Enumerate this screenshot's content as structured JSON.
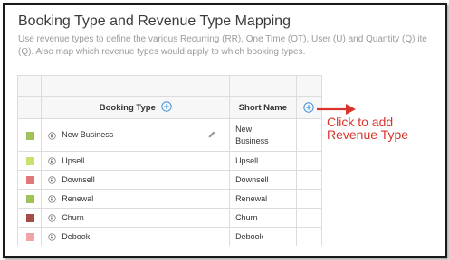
{
  "page": {
    "title": "Booking Type and Revenue Type Mapping",
    "description_line1": "Use revenue types to define the various Recurring (RR), One Time (OT), User (U) and Quantity (Q) ite",
    "description_line2": "(Q). Also map which revenue types would apply to which booking types."
  },
  "table": {
    "columns": {
      "booking_type": "Booking Type",
      "short_name": "Short Name"
    },
    "rows": [
      {
        "color": "#9dc35a",
        "name": "New Business",
        "short_line1": "New",
        "short_line2": "Business"
      },
      {
        "color": "#c9e072",
        "name": "Upsell",
        "short": "Upsell"
      },
      {
        "color": "#e07a7a",
        "name": "Downsell",
        "short": "Downsell"
      },
      {
        "color": "#9dc35a",
        "name": "Renewal",
        "short": "Renewal"
      },
      {
        "color": "#a44d47",
        "name": "Churn",
        "short": "Churn"
      },
      {
        "color": "#f0a5a5",
        "name": "Debook",
        "short": "Debook"
      }
    ]
  },
  "annotation": {
    "line1": "Click to add",
    "line2": "Revenue Type",
    "color": "#d9342b"
  },
  "icons": {
    "add": "plus-circle-icon",
    "lock": "lock-icon",
    "edit": "pencil-icon"
  }
}
